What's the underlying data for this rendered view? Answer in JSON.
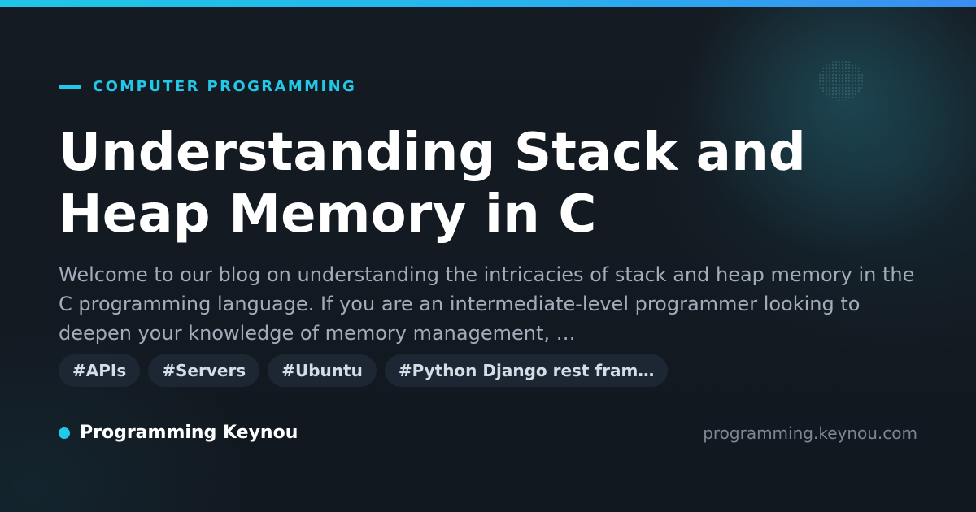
{
  "card": {
    "category": "COMPUTER PROGRAMMING",
    "title": "Understanding Stack and Heap Memory in C",
    "description": "Welcome to our blog on understanding the intricacies of stack and heap memory in the C programming language. If you are an intermediate-level programmer looking to deepen your knowledge of memory management, …",
    "tags": [
      "#APIs",
      "#Servers",
      "#Ubuntu",
      "#Python Django rest fram…"
    ],
    "brand_name": "Programming Keynou",
    "domain": "programming.keynou.com"
  },
  "colors": {
    "accent": "#22c8e8",
    "top_bar_gradient": [
      "#1fc6e6",
      "#3a8ef2"
    ],
    "background": "#141a22",
    "title_text": "#ffffff",
    "description_text": "#a3adba",
    "tag_background": "#1d2733",
    "tag_text": "#d6dde6",
    "domain_text": "#7d8793"
  },
  "icons": {
    "category_marker": "dash",
    "brand_marker": "dot"
  }
}
